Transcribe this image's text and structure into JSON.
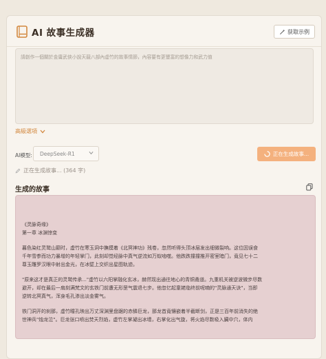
{
  "header": {
    "title": "AI 故事生成器",
    "example_button": "获取示例"
  },
  "prompt": {
    "placeholder": "請創作一個關於金庸武俠小說天龍八部內虛竹的故事情節，內容要有更豐富的想像力和武力值"
  },
  "advanced": {
    "label": "高級選項"
  },
  "model": {
    "label": "AI模型:",
    "selected": "DeepSeek-R1"
  },
  "generate_button": {
    "label": "正在生成故事..."
  },
  "status": {
    "text": "正在生成故事... (364 字)"
  },
  "story_section": {
    "title": "生成的故事"
  },
  "story": {
    "heading_lines": [
      "《灵脉奇缘》",
      "第一章 冰渊惊变"
    ],
    "paragraphs": [
      [
        "暮色染红灵鹫山巅时，虚竹在寒玉洞中撫摸着《北冥神功》残卷，忽然听得头顶冰层发出细微裂响。这位因误食",
        "千年雪参而功力暴增的年轻掌门，此刻却觉经脉中真气逆流如万蚁啮噬。他跌跌撞撞推开密室暗门，竟见七十二",
        "尊玉雕罗汉眼中射出金光，在冰壁上交织出星图轨迹。"
      ],
      [
        "\"原来这才是真正的灵鹫传承...\"虚竹以六阳掌融化玄冰，赫然现出通往地心的青铜甬道。九重机关被逆波微步尽数",
        "避开，却在最后一扇刻满梵文的玄铁门前遭无形罡气震退七步。他忽忆起童姥临终前呢喃的\"灵脉通天诀\"，当即",
        "逆转北冥真气，浑身毛孔渗出淡金雾气。"
      ],
      [
        "铁门洞开的刹那，虚竹瞳孔映出万丈深渊里盘踞的赤鳞巨龙，那龙首竟镶嵌着半截断剑，正是三百年前消失的绝",
        "世神兵\"烛龙泣\"。巨龙张口喷出焚天烈焰，虚竹左掌凝出冰墙，右掌化出气旋，将火焰尽数吸入臟中穴，体内"
      ]
    ]
  },
  "colors": {
    "accent": "#d2873d",
    "generate_button_bg": "#f4b17e",
    "story_bg": "#e6d0d1",
    "page_bg": "#efe9df"
  }
}
